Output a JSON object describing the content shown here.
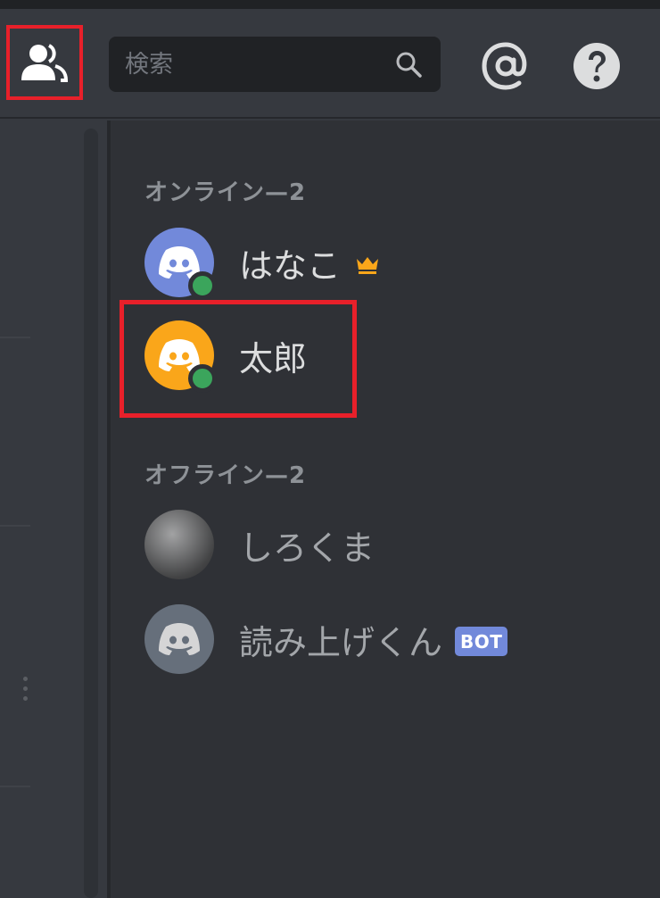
{
  "header": {
    "search": {
      "placeholder": "検索"
    }
  },
  "member_list": {
    "sections": [
      {
        "title": "オンライン—2",
        "members": [
          {
            "name": "はなこ",
            "avatar_color": "#7289da",
            "status": "online",
            "owner_crown": true
          },
          {
            "name": "太郎",
            "avatar_color": "#faa61a",
            "status": "online"
          }
        ]
      },
      {
        "title": "オフライン—2",
        "members": [
          {
            "name": "しろくま",
            "avatar": "photo"
          },
          {
            "name": "読み上げくん",
            "avatar_color": "#747f8d",
            "tag": "BOT"
          }
        ]
      }
    ]
  },
  "colors": {
    "highlight": "#e8202a",
    "online": "#3ba55c",
    "crown": "#faa61a",
    "bot_tag": "#7289da"
  },
  "icons": [
    "members-icon",
    "search-icon",
    "mention-icon",
    "help-icon",
    "discord-logo-icon",
    "crown-icon"
  ]
}
